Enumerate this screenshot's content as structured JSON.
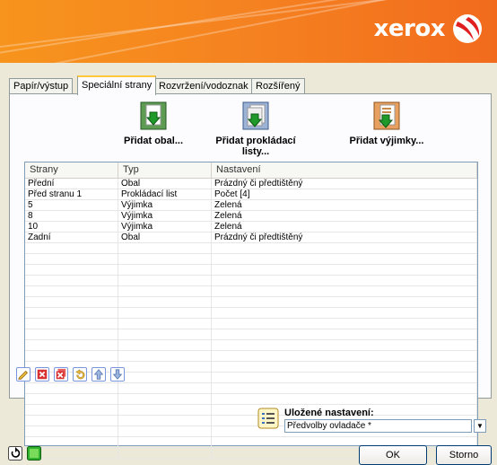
{
  "brand": {
    "logo_text": "xerox",
    "accent": "#F58220"
  },
  "tabs": [
    {
      "label": "Papír/výstup"
    },
    {
      "label": "Speciální strany",
      "active": true
    },
    {
      "label": "Rozvržení/vodoznak"
    },
    {
      "label": "Rozšířený"
    }
  ],
  "toolbar": {
    "add_cover": "Přidat obal...",
    "add_inserts_line1": "Přidat prokládací",
    "add_inserts_line2": "listy...",
    "add_exceptions": "Přidat výjimky..."
  },
  "table": {
    "headers": [
      "Strany",
      "Typ",
      "Nastavení"
    ],
    "rows": [
      [
        "Přední",
        "Obal",
        "Prázdný či předtištěný"
      ],
      [
        "Před stranu 1",
        "Prokládací list",
        "Počet [4]"
      ],
      [
        "5",
        "Výjimka",
        "Zelená"
      ],
      [
        "8",
        "Výjimka",
        "Zelená"
      ],
      [
        "10",
        "Výjimka",
        "Zelená"
      ],
      [
        "Zadní",
        "Obal",
        "Prázdný či předtištěný"
      ]
    ]
  },
  "action_icons": [
    "edit-icon",
    "delete-icon",
    "delete-all-icon",
    "undo-icon",
    "move-up-icon",
    "move-down-icon"
  ],
  "saved_settings": {
    "label": "Uložené nastavení:",
    "value": "Předvolby ovladače *"
  },
  "buttons": {
    "ok": "OK",
    "cancel": "Storno"
  }
}
